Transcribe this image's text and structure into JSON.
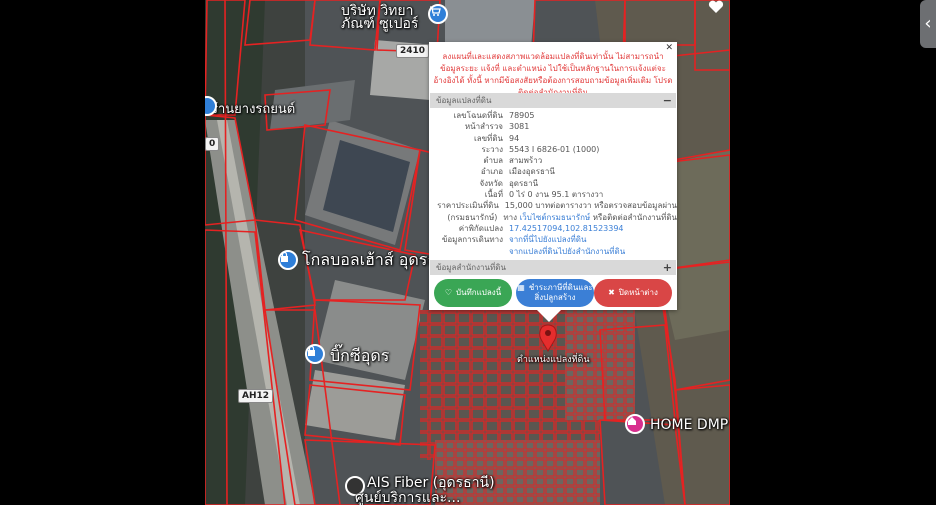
{
  "map": {
    "labels": {
      "company_line1": "บริษัท วิทยา",
      "company_line2": "ภัณฑ์ ซูเปอร์",
      "road_2410": "2410",
      "road_0": "0",
      "road_ah12": "AH12",
      "shop": "ร้านยางรถยนต์",
      "global_house": "โกลบอลเฮ้าส์ อุดรธานี",
      "big_c": "บิ๊กซีอุดร",
      "home_dmp": "HOME DMP",
      "ais_line1": "AIS Fiber (อุดรธานี)",
      "ais_line2": "ศูนย์บริการและ...",
      "parcel_location": "ตำแหน่งแปลงที่ดิน"
    },
    "colors": {
      "parcel_outline": "#e52222",
      "marker": "#e52d2d"
    }
  },
  "popup": {
    "warning": "ลงแผนที่และแสดงสภาพแวดล้อมแปลงที่ดินเท่านั้น ไม่สามารถนำข้อมูลระยะ แจ้งที่ และตำแหน่ง ไปใช้เป็นหลักฐานในการแจ้งแต่จะอ้างอิงได้ ทั้งนี้ หากมีข้อสงสัยหรือต้องการสอบถามข้อมูลเพิ่มเติม โปรดติดต่อสำนักงานที่ดิน",
    "section_land": "ข้อมูลแปลงที่ดิน",
    "section_office": "ข้อมูลสำนักงานที่ดิน",
    "rows": [
      {
        "k": "เลขโฉนดที่ดิน",
        "v": "78905"
      },
      {
        "k": "หน้าสำรวจ",
        "v": "3081"
      },
      {
        "k": "เลขที่ดิน",
        "v": "94"
      },
      {
        "k": "ระวาง",
        "v": "5543 I 6826-01 (1000)"
      },
      {
        "k": "ตำบล",
        "v": "สามพร้าว"
      },
      {
        "k": "อำเภอ",
        "v": "เมืองอุดรธานี"
      },
      {
        "k": "จังหวัด",
        "v": "อุดรธานี"
      },
      {
        "k": "เนื้อที่",
        "v": "0 ไร่ 0 งาน 95.1 ตารางวา"
      },
      {
        "k": "ราคาประเมินที่ดิน",
        "v": "15,000 บาทต่อตารางวา หรือตรวจสอบข้อมูลผ่าน"
      }
    ],
    "treasury_label": "(กรมธนารักษ์)",
    "treasury_pre": "ทาง",
    "treasury_link": "เว็บไซต์กรมธนารักษ์",
    "treasury_post": "หรือติดต่อสำนักงานที่ดิน",
    "coord_label": "ค่าพิกัดแปลง",
    "coord_value": "17.42517094,102.81523394",
    "route_label": "ข้อมูลการเดินทาง",
    "route_link1": "จากที่นี่ไปยังแปลงที่ดิน",
    "route_link2": "จากแปลงที่ดินไปยังสำนักงานที่ดิน",
    "buttons": {
      "save": "บันทึกแปลงนี้",
      "tax_line1": "ชำระภาษีที่ดินและ",
      "tax_line2": "สิ่งปลูกสร้าง",
      "close": "ปิดหน้าต่าง"
    }
  }
}
